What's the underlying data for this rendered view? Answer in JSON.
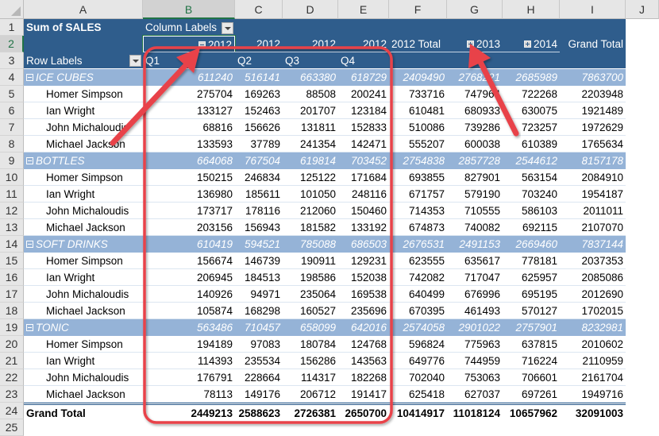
{
  "columns": [
    "A",
    "B",
    "C",
    "D",
    "E",
    "F",
    "G",
    "H",
    "I",
    "J"
  ],
  "selected_column": "B",
  "selected_row": "2",
  "row_numbers": [
    "1",
    "2",
    "3",
    "4",
    "5",
    "6",
    "7",
    "8",
    "9",
    "10",
    "11",
    "12",
    "13",
    "14",
    "15",
    "16",
    "17",
    "18",
    "19",
    "20",
    "21",
    "22",
    "23",
    "24",
    "25"
  ],
  "pivot": {
    "values_label": "Sum of SALES",
    "column_labels": "Column Labels",
    "row_labels": "Row Labels",
    "year_headers": {
      "b": "2012",
      "c": "2012",
      "d": "2012",
      "e": "2012",
      "f": "2012 Total",
      "g": "2013",
      "h": "2014",
      "i": "Grand Total"
    },
    "quarters": [
      "Q1",
      "Q2",
      "Q3",
      "Q4"
    ],
    "categories": [
      {
        "name": "ICE CUBES",
        "values": [
          "611240",
          "516141",
          "663380",
          "618729",
          "2409490",
          "2768221",
          "2685989",
          "7863700"
        ],
        "rows": [
          {
            "name": "Homer Simpson",
            "values": [
              "275704",
              "169263",
              "88508",
              "200241",
              "733716",
              "747964",
              "722268",
              "2203948"
            ]
          },
          {
            "name": "Ian Wright",
            "values": [
              "133127",
              "152463",
              "201707",
              "123184",
              "610481",
              "680933",
              "630075",
              "1921489"
            ]
          },
          {
            "name": "John Michaloudis",
            "values": [
              "68816",
              "156626",
              "131811",
              "152833",
              "510086",
              "739286",
              "723257",
              "1972629"
            ]
          },
          {
            "name": "Michael Jackson",
            "values": [
              "133593",
              "37789",
              "241354",
              "142471",
              "555207",
              "600038",
              "610389",
              "1765634"
            ]
          }
        ]
      },
      {
        "name": "BOTTLES",
        "values": [
          "664068",
          "767504",
          "619814",
          "703452",
          "2754838",
          "2857728",
          "2544612",
          "8157178"
        ],
        "rows": [
          {
            "name": "Homer Simpson",
            "values": [
              "150215",
              "246834",
              "125122",
              "171684",
              "693855",
              "827901",
              "563154",
              "2084910"
            ]
          },
          {
            "name": "Ian Wright",
            "values": [
              "136980",
              "185611",
              "101050",
              "248116",
              "671757",
              "579190",
              "703240",
              "1954187"
            ]
          },
          {
            "name": "John Michaloudis",
            "values": [
              "173717",
              "178116",
              "212060",
              "150460",
              "714353",
              "710555",
              "586103",
              "2011011"
            ]
          },
          {
            "name": "Michael Jackson",
            "values": [
              "203156",
              "156943",
              "181582",
              "133192",
              "674873",
              "740082",
              "692115",
              "2107070"
            ]
          }
        ]
      },
      {
        "name": "SOFT DRINKS",
        "values": [
          "610419",
          "594521",
          "785088",
          "686503",
          "2676531",
          "2491153",
          "2669460",
          "7837144"
        ],
        "rows": [
          {
            "name": "Homer Simpson",
            "values": [
              "156674",
              "146739",
              "190911",
              "129231",
              "623555",
              "635617",
              "778181",
              "2037353"
            ]
          },
          {
            "name": "Ian Wright",
            "values": [
              "206945",
              "184513",
              "198586",
              "152038",
              "742082",
              "717047",
              "625957",
              "2085086"
            ]
          },
          {
            "name": "John Michaloudis",
            "values": [
              "140926",
              "94971",
              "235064",
              "169538",
              "640499",
              "676996",
              "695195",
              "2012690"
            ]
          },
          {
            "name": "Michael Jackson",
            "values": [
              "105874",
              "168298",
              "160527",
              "235696",
              "670395",
              "461493",
              "570127",
              "1702015"
            ]
          }
        ]
      },
      {
        "name": "TONIC",
        "values": [
          "563486",
          "710457",
          "658099",
          "642016",
          "2574058",
          "2901022",
          "2757901",
          "8232981"
        ],
        "rows": [
          {
            "name": "Homer Simpson",
            "values": [
              "194189",
              "97083",
              "180784",
              "124768",
              "596824",
              "775963",
              "637815",
              "2010602"
            ]
          },
          {
            "name": "Ian Wright",
            "values": [
              "114393",
              "235534",
              "156286",
              "143563",
              "649776",
              "744959",
              "716224",
              "2110959"
            ]
          },
          {
            "name": "John Michaloudis",
            "values": [
              "176791",
              "228664",
              "114317",
              "182268",
              "702040",
              "753063",
              "706601",
              "2161704"
            ]
          },
          {
            "name": "Michael Jackson",
            "values": [
              "78113",
              "149176",
              "206712",
              "191417",
              "625418",
              "627037",
              "697261",
              "1949716"
            ]
          }
        ]
      }
    ],
    "grand_total": {
      "label": "Grand Total",
      "values": [
        "2449213",
        "2588623",
        "2726381",
        "2650700",
        "10414917",
        "11018124",
        "10657962",
        "32091003"
      ]
    }
  },
  "annotations": {
    "highlight_color": "#e8424a",
    "header_color": "#2f5d8c",
    "category_row_color": "#95b3d7"
  }
}
